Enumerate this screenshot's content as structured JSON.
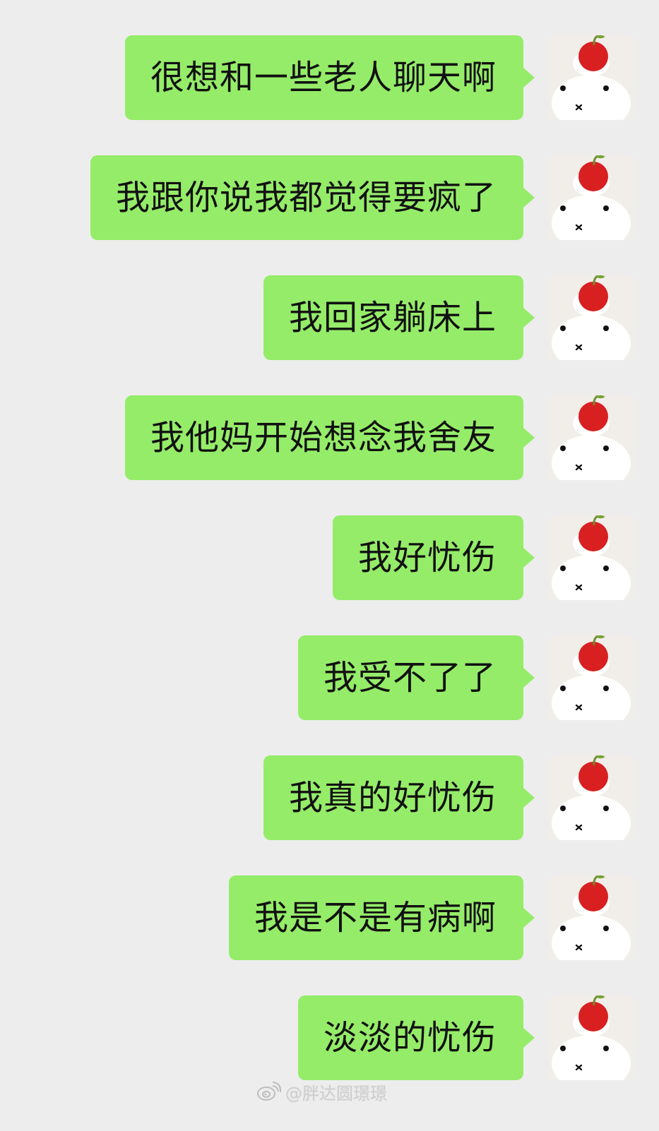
{
  "chat": {
    "accent_color": "#95ec69",
    "background_color": "#ededed",
    "messages": [
      {
        "text": "很想和一些老人聊天啊"
      },
      {
        "text": "我跟你说我都觉得要疯了"
      },
      {
        "text": "我回家躺床上"
      },
      {
        "text": "我他妈开始想念我舍友"
      },
      {
        "text": "我好忧伤"
      },
      {
        "text": "我受不了了"
      },
      {
        "text": "我真的好忧伤"
      },
      {
        "text": "我是不是有病啊"
      },
      {
        "text": "淡淡的忧伤"
      }
    ],
    "avatar_icon": "cartoon-bunny-with-cherry-icon"
  },
  "watermark": {
    "icon": "weibo-icon",
    "text": "@胖达圆璟璟"
  }
}
